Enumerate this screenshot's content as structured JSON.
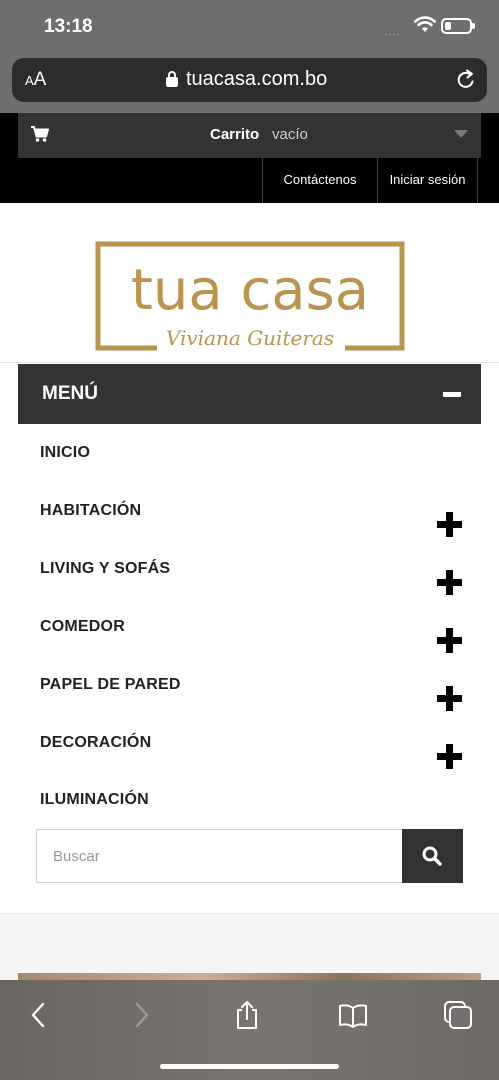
{
  "status_bar": {
    "time": "13:18",
    "signal": "....",
    "battery_level": 0.25
  },
  "browser": {
    "text_size_label_small": "A",
    "text_size_label_large": "A",
    "url": "tuacasa.com.bo"
  },
  "header": {
    "cart_label": "Carrito",
    "cart_status": "vacío",
    "contact_link": "Contáctenos",
    "login_link": "Iniciar sesión"
  },
  "logo": {
    "brand": "tua casa",
    "subtitle": "Viviana Guiteras",
    "color": "#b8944f"
  },
  "menu": {
    "title": "MENÚ",
    "items": [
      {
        "label": "INICIO",
        "expandable": false
      },
      {
        "label": "HABITACIÓN",
        "expandable": true
      },
      {
        "label": "LIVING Y SOFÁS",
        "expandable": true
      },
      {
        "label": "COMEDOR",
        "expandable": true
      },
      {
        "label": "PAPEL DE PARED",
        "expandable": true
      },
      {
        "label": "DECORACIÓN",
        "expandable": true
      },
      {
        "label": "ILUMINACIÓN",
        "expandable": false
      }
    ]
  },
  "search": {
    "placeholder": "Buscar"
  },
  "icons": {
    "cart": "cart-icon",
    "lock": "lock-icon",
    "reload": "reload-icon",
    "search": "search-icon",
    "back": "chevron-left-icon",
    "forward": "chevron-right-icon",
    "share": "share-icon",
    "bookmarks": "book-icon",
    "tabs": "tabs-icon"
  },
  "colors": {
    "dark_bar": "#333333",
    "accent_gold": "#b8944f"
  }
}
